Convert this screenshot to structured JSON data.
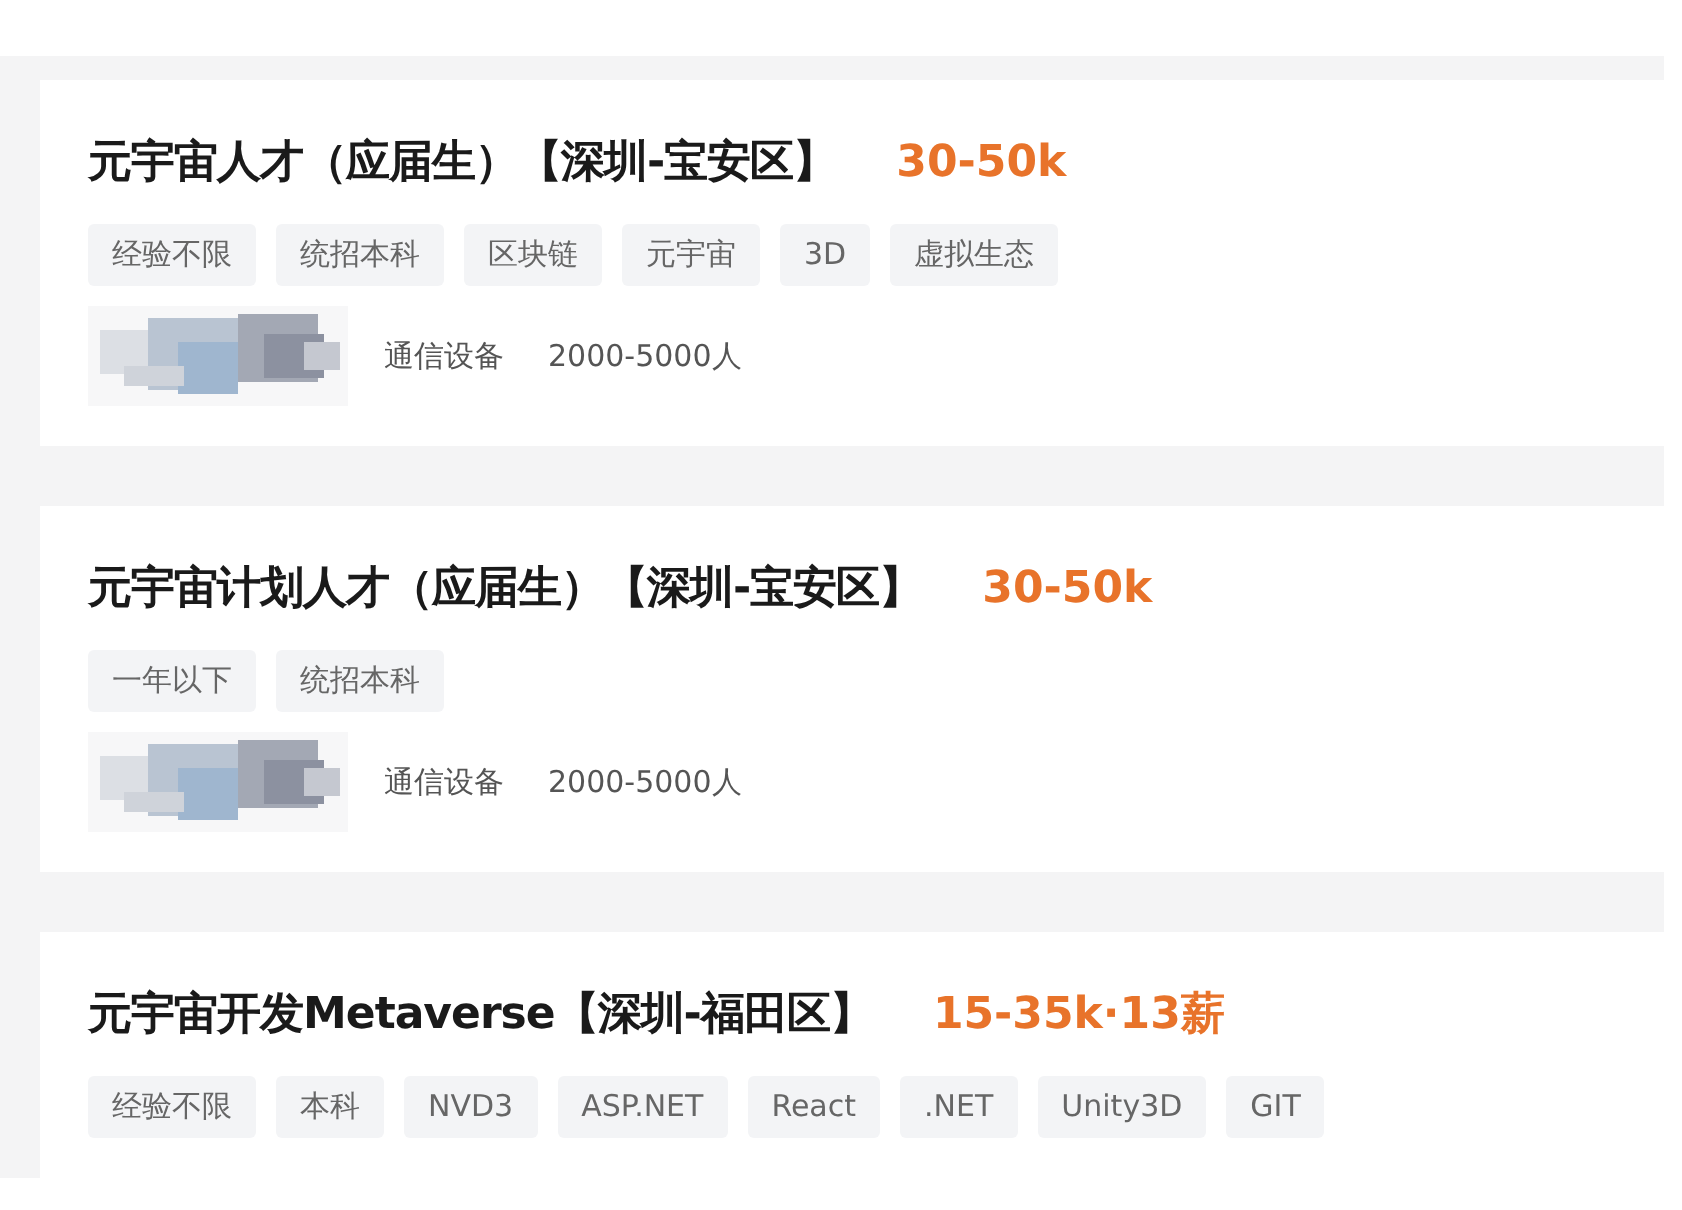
{
  "jobs": [
    {
      "title": "元宇宙人才（应届生）【深圳-宝安区】",
      "salary": "30-50k",
      "tags": [
        "经验不限",
        "统招本科",
        "区块链",
        "元宇宙",
        "3D",
        "虚拟生态"
      ],
      "company": {
        "industry": "通信设备",
        "size": "2000-5000人"
      }
    },
    {
      "title": "元宇宙计划人才（应届生）【深圳-宝安区】",
      "salary": "30-50k",
      "tags": [
        "一年以下",
        "统招本科"
      ],
      "company": {
        "industry": "通信设备",
        "size": "2000-5000人"
      }
    },
    {
      "title": "元宇宙开发Metaverse【深圳-福田区】",
      "salary": "15-35k·13薪",
      "tags": [
        "经验不限",
        "本科",
        "NVD3",
        "ASP.NET",
        "React",
        ".NET",
        "Unity3D",
        "GIT"
      ]
    }
  ]
}
